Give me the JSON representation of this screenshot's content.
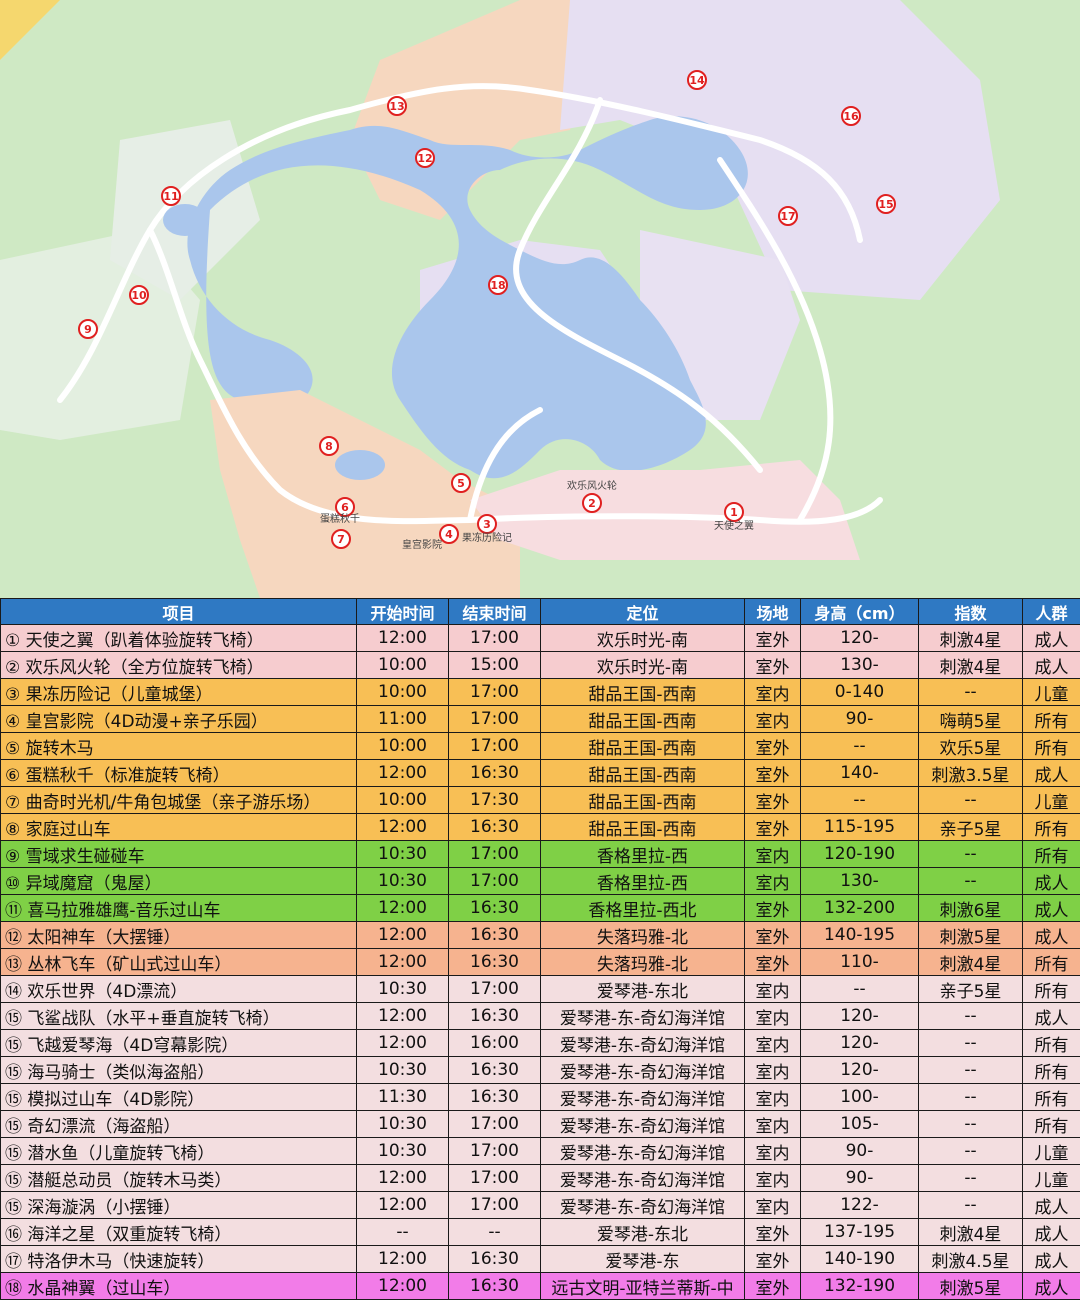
{
  "map": {
    "markers": [
      {
        "num": "1",
        "label": "天使之翼"
      },
      {
        "num": "2",
        "label": "欢乐风火轮"
      },
      {
        "num": "3",
        "label": "果冻历险记"
      },
      {
        "num": "4",
        "label": ""
      },
      {
        "num": "5",
        "label": ""
      },
      {
        "num": "6",
        "label": "蛋糕秋千"
      },
      {
        "num": "7",
        "label": ""
      },
      {
        "num": "8",
        "label": ""
      },
      {
        "num": "9",
        "label": ""
      },
      {
        "num": "10",
        "label": ""
      },
      {
        "num": "11",
        "label": ""
      },
      {
        "num": "12",
        "label": ""
      },
      {
        "num": "13",
        "label": ""
      },
      {
        "num": "14",
        "label": ""
      },
      {
        "num": "15",
        "label": ""
      },
      {
        "num": "16",
        "label": ""
      },
      {
        "num": "17",
        "label": ""
      },
      {
        "num": "18",
        "label": ""
      }
    ],
    "extra_labels": [
      "皇宫影院"
    ]
  },
  "table": {
    "headers": [
      "项目",
      "开始时间",
      "结束时间",
      "定位",
      "场地",
      "身高（cm）",
      "指数",
      "人群"
    ],
    "rows": [
      {
        "style": "pink",
        "name": "① 天使之翼（趴着体验旋转飞椅）",
        "start": "12:00",
        "end": "17:00",
        "loc": "欢乐时光-南",
        "venue": "室外",
        "height": "120-",
        "index": "刺激4星",
        "crowd": "成人"
      },
      {
        "style": "pink",
        "name": "② 欢乐风火轮（全方位旋转飞椅）",
        "start": "10:00",
        "end": "15:00",
        "loc": "欢乐时光-南",
        "venue": "室外",
        "height": "130-",
        "index": "刺激4星",
        "crowd": "成人"
      },
      {
        "style": "orange",
        "name": "③ 果冻历险记（儿童城堡）",
        "start": "10:00",
        "end": "17:00",
        "loc": "甜品王国-西南",
        "venue": "室内",
        "height": "0-140",
        "index": "--",
        "crowd": "儿童"
      },
      {
        "style": "orange",
        "name": "④ 皇宫影院（4D动漫+亲子乐园）",
        "start": "11:00",
        "end": "17:00",
        "loc": "甜品王国-西南",
        "venue": "室内",
        "height": "90-",
        "index": "嗨萌5星",
        "crowd": "所有"
      },
      {
        "style": "orange",
        "name": "⑤ 旋转木马",
        "start": "10:00",
        "end": "17:00",
        "loc": "甜品王国-西南",
        "venue": "室外",
        "height": "--",
        "index": "欢乐5星",
        "crowd": "所有"
      },
      {
        "style": "orange",
        "name": "⑥ 蛋糕秋千（标准旋转飞椅）",
        "start": "12:00",
        "end": "16:30",
        "loc": "甜品王国-西南",
        "venue": "室外",
        "height": "140-",
        "index": "刺激3.5星",
        "crowd": "成人"
      },
      {
        "style": "orange",
        "name": "⑦ 曲奇时光机/牛角包城堡（亲子游乐场）",
        "start": "10:00",
        "end": "17:30",
        "loc": "甜品王国-西南",
        "venue": "室外",
        "height": "--",
        "index": "--",
        "crowd": "儿童"
      },
      {
        "style": "orange",
        "name": "⑧ 家庭过山车",
        "start": "12:00",
        "end": "16:30",
        "loc": "甜品王国-西南",
        "venue": "室外",
        "height": "115-195",
        "index": "亲子5星",
        "crowd": "所有"
      },
      {
        "style": "green",
        "name": "⑨ 雪域求生碰碰车",
        "start": "10:30",
        "end": "17:00",
        "loc": "香格里拉-西",
        "venue": "室内",
        "height": "120-190",
        "index": "--",
        "crowd": "所有"
      },
      {
        "style": "green",
        "name": "⑩ 异域魔窟（鬼屋）",
        "start": "10:30",
        "end": "17:00",
        "loc": "香格里拉-西",
        "venue": "室内",
        "height": "130-",
        "index": "--",
        "crowd": "成人"
      },
      {
        "style": "green",
        "name": "⑪ 喜马拉雅雄鹰-音乐过山车",
        "start": "12:00",
        "end": "16:30",
        "loc": "香格里拉-西北",
        "venue": "室外",
        "height": "132-200",
        "index": "刺激6星",
        "crowd": "成人"
      },
      {
        "style": "salmon",
        "name": "⑫ 太阳神车（大摆锤）",
        "start": "12:00",
        "end": "16:30",
        "loc": "失落玛雅-北",
        "venue": "室外",
        "height": "140-195",
        "index": "刺激5星",
        "crowd": "成人"
      },
      {
        "style": "salmon",
        "name": "⑬ 丛林飞车（矿山式过山车）",
        "start": "12:00",
        "end": "16:30",
        "loc": "失落玛雅-北",
        "venue": "室外",
        "height": "110-",
        "index": "刺激4星",
        "crowd": "所有"
      },
      {
        "style": "lpink",
        "name": "⑭ 欢乐世界（4D漂流）",
        "start": "10:30",
        "end": "17:00",
        "loc": "爱琴港-东北",
        "venue": "室内",
        "height": "--",
        "index": "亲子5星",
        "crowd": "所有"
      },
      {
        "style": "lpink",
        "name": "⑮ 飞鲨战队（水平+垂直旋转飞椅）",
        "start": "12:00",
        "end": "16:30",
        "loc": "爱琴港-东-奇幻海洋馆",
        "venue": "室内",
        "height": "120-",
        "index": "--",
        "crowd": "成人"
      },
      {
        "style": "lpink",
        "name": "⑮ 飞越爱琴海（4D穹幕影院）",
        "start": "12:00",
        "end": "16:00",
        "loc": "爱琴港-东-奇幻海洋馆",
        "venue": "室内",
        "height": "120-",
        "index": "--",
        "crowd": "所有"
      },
      {
        "style": "lpink",
        "name": "⑮ 海马骑士（类似海盗船）",
        "start": "10:30",
        "end": "16:30",
        "loc": "爱琴港-东-奇幻海洋馆",
        "venue": "室内",
        "height": "120-",
        "index": "--",
        "crowd": "所有"
      },
      {
        "style": "lpink",
        "name": "⑮ 模拟过山车（4D影院）",
        "start": "11:30",
        "end": "16:30",
        "loc": "爱琴港-东-奇幻海洋馆",
        "venue": "室内",
        "height": "100-",
        "index": "--",
        "crowd": "所有"
      },
      {
        "style": "lpink",
        "name": "⑮ 奇幻漂流（海盗船）",
        "start": "10:30",
        "end": "17:00",
        "loc": "爱琴港-东-奇幻海洋馆",
        "venue": "室内",
        "height": "105-",
        "index": "--",
        "crowd": "所有"
      },
      {
        "style": "lpink",
        "name": "⑮ 潜水鱼（儿童旋转飞椅）",
        "start": "10:30",
        "end": "17:00",
        "loc": "爱琴港-东-奇幻海洋馆",
        "venue": "室内",
        "height": "90-",
        "index": "--",
        "crowd": "儿童"
      },
      {
        "style": "lpink",
        "name": "⑮ 潜艇总动员（旋转木马类）",
        "start": "12:00",
        "end": "17:00",
        "loc": "爱琴港-东-奇幻海洋馆",
        "venue": "室内",
        "height": "90-",
        "index": "--",
        "crowd": "儿童"
      },
      {
        "style": "lpink",
        "name": "⑮ 深海漩涡（小摆锤）",
        "start": "12:00",
        "end": "17:00",
        "loc": "爱琴港-东-奇幻海洋馆",
        "venue": "室内",
        "height": "122-",
        "index": "--",
        "crowd": "成人"
      },
      {
        "style": "lpink",
        "name": "⑯ 海洋之星（双重旋转飞椅）",
        "start": "--",
        "end": "--",
        "loc": "爱琴港-东北",
        "venue": "室外",
        "height": "137-195",
        "index": "刺激4星",
        "crowd": "成人"
      },
      {
        "style": "lpink",
        "name": "⑰ 特洛伊木马（快速旋转）",
        "start": "12:00",
        "end": "16:30",
        "loc": "爱琴港-东",
        "venue": "室外",
        "height": "140-190",
        "index": "刺激4.5星",
        "crowd": "成人"
      },
      {
        "style": "magenta",
        "name": "⑱ 水晶神翼（过山车）",
        "start": "12:00",
        "end": "16:30",
        "loc": "远古文明-亚特兰蒂斯-中",
        "venue": "室外",
        "height": "132-190",
        "index": "刺激5星",
        "crowd": "成人"
      }
    ]
  }
}
